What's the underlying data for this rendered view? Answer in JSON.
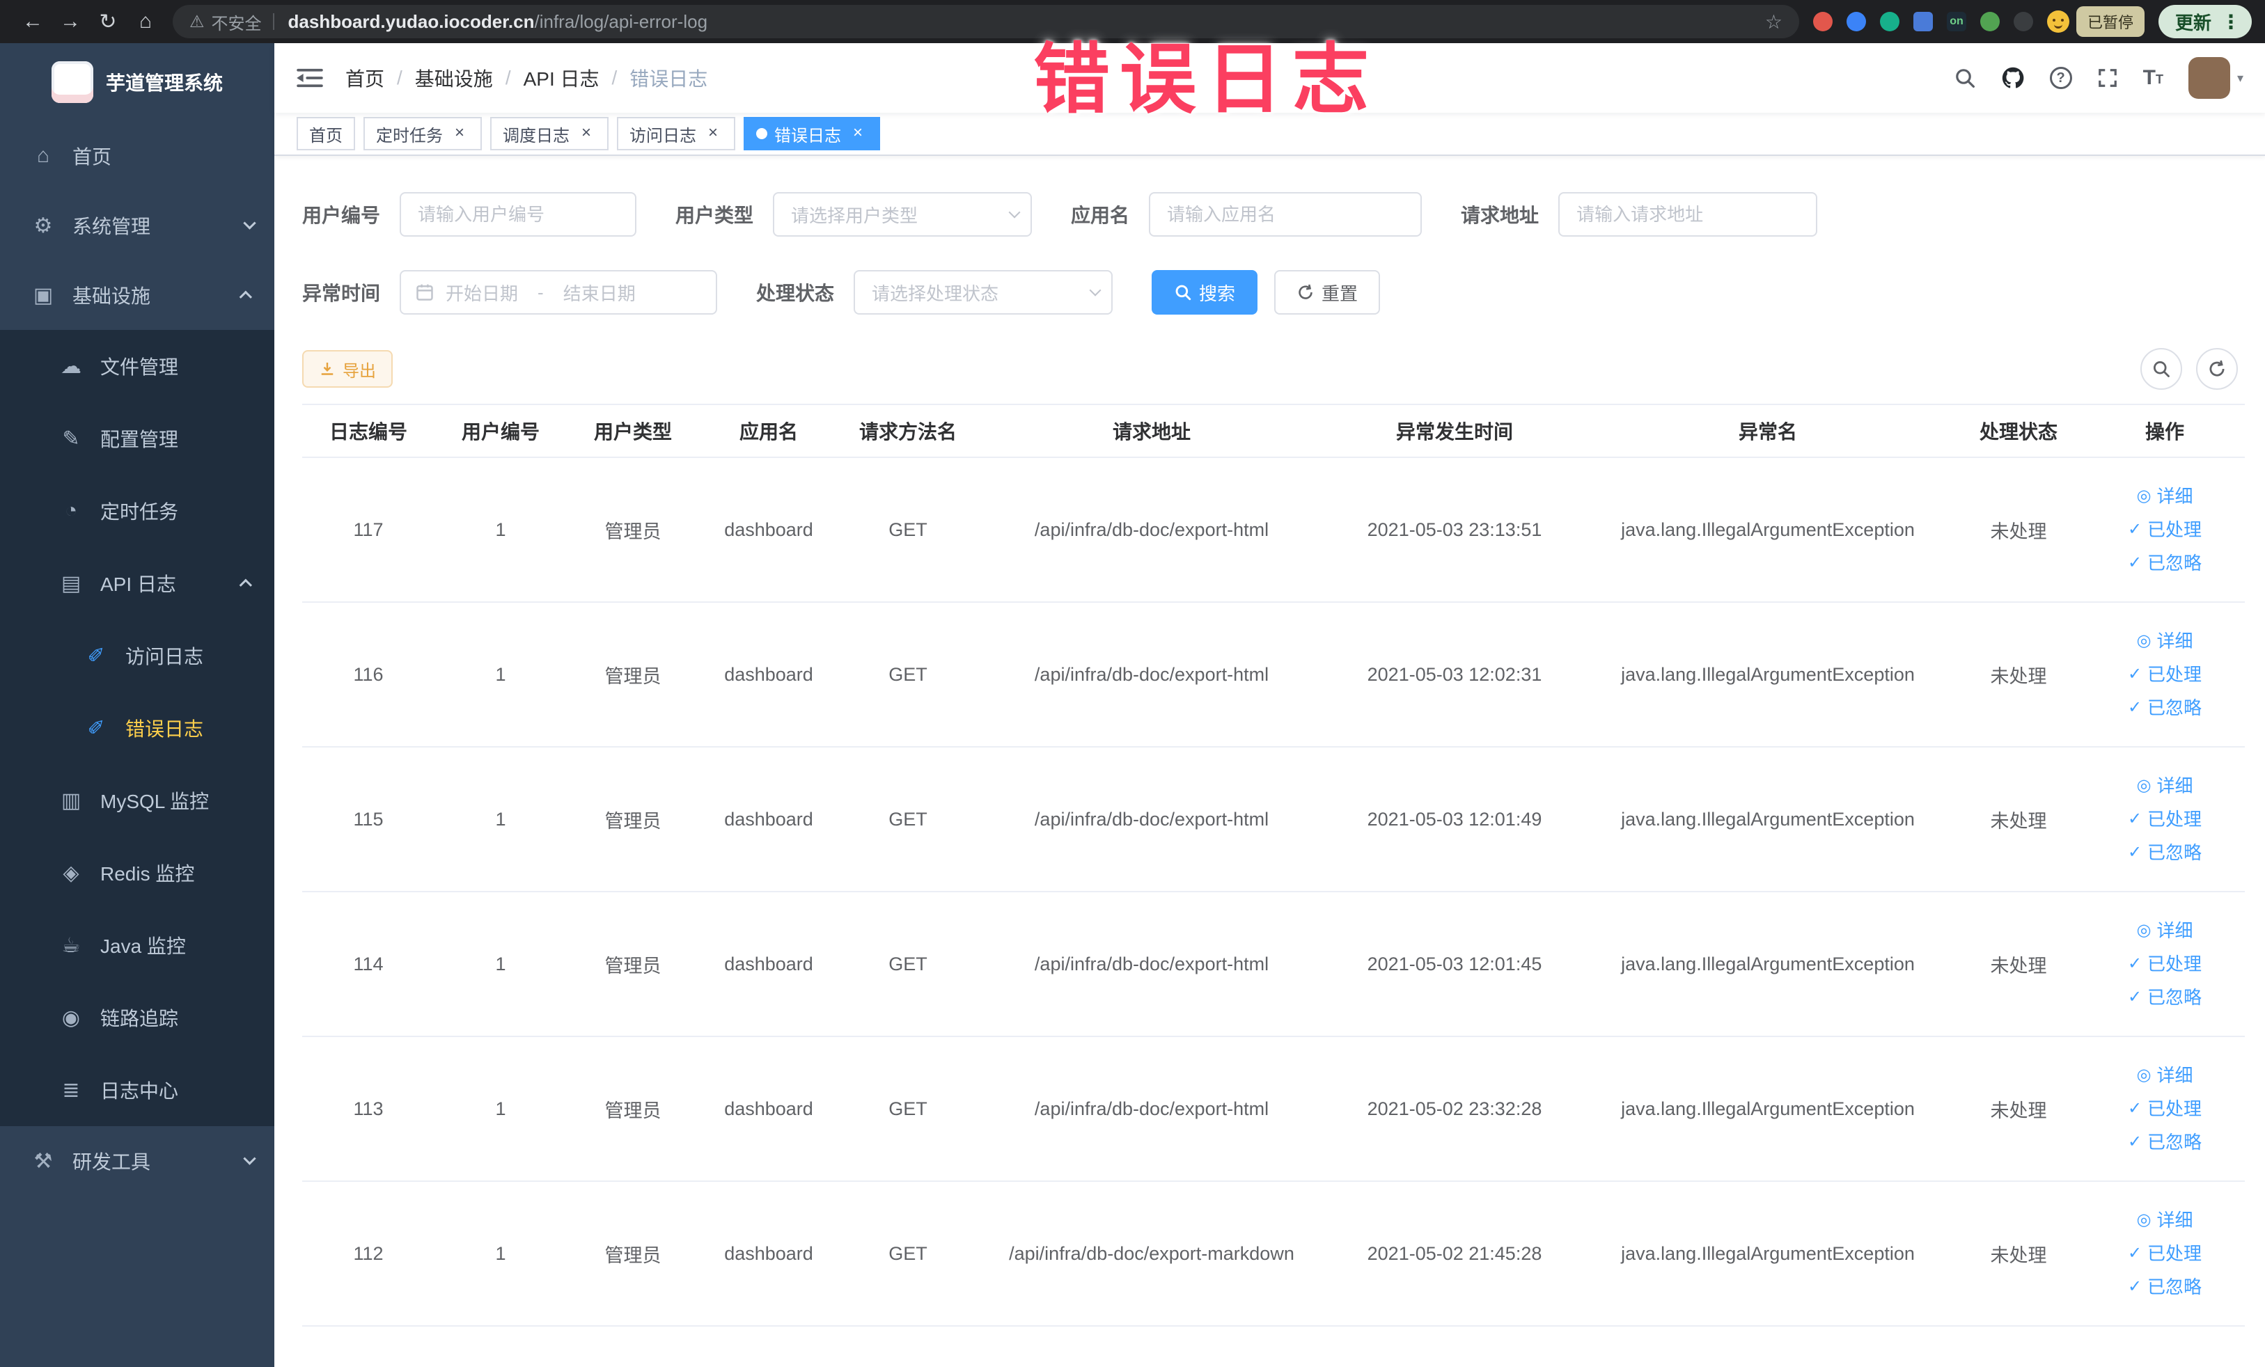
{
  "colors": {
    "primary": "#409eff",
    "sidebar_bg": "#304156",
    "submenu_bg": "#1f2d3d",
    "menu_text": "#bfcbd9",
    "active_menu_text": "#ffd04b",
    "annotation": "#fb3f60",
    "warning": "#e6a23c"
  },
  "icons": {
    "back": "←",
    "forward": "→",
    "reload": "↻",
    "home_nav": "⌂",
    "warning": "⚠",
    "star": "☆",
    "kebab": "⋮",
    "caret_down": "▾",
    "home": "⌂",
    "system": "⚙",
    "infra": "▣",
    "file": "☁",
    "config": "✎",
    "job": "◔",
    "api_log": "▤",
    "access_log": "✐",
    "error_log": "✐",
    "mysql": "▥",
    "redis": "◈",
    "java": "☕",
    "trace": "◉",
    "log_center": "≣",
    "dev_tools": "⚒",
    "eye": "◎",
    "check": "✓"
  },
  "browser": {
    "security_label": "不安全",
    "url_host": "dashboard.yudao.iocoder.cn",
    "url_path": "/infra/log/api-error-log",
    "extension_on_label": "on",
    "paused_badge": "已暂停",
    "update_button": "更新"
  },
  "annotation": {
    "text": "错误日志"
  },
  "sidebar": {
    "title": "芋道管理系统",
    "home": "首页",
    "system": "系统管理",
    "infra": "基础设施",
    "file": "文件管理",
    "config": "配置管理",
    "job": "定时任务",
    "api_log": "API 日志",
    "access_log": "访问日志",
    "error_log": "错误日志",
    "mysql": "MySQL 监控",
    "redis": "Redis 监控",
    "java": "Java 监控",
    "trace": "链路追踪",
    "log_center": "日志中心",
    "dev_tools": "研发工具"
  },
  "breadcrumb": [
    "首页",
    "基础设施",
    "API 日志",
    "错误日志"
  ],
  "tabs": [
    {
      "label": "首页"
    },
    {
      "label": "定时任务"
    },
    {
      "label": "调度日志"
    },
    {
      "label": "访问日志"
    },
    {
      "label": "错误日志"
    }
  ],
  "filters": {
    "user_id": {
      "label": "用户编号",
      "placeholder": "请输入用户编号"
    },
    "user_type": {
      "label": "用户类型",
      "placeholder": "请选择用户类型"
    },
    "app_name": {
      "label": "应用名",
      "placeholder": "请输入应用名"
    },
    "request_url": {
      "label": "请求地址",
      "placeholder": "请输入请求地址"
    },
    "exception_time": {
      "label": "异常时间",
      "start_placeholder": "开始日期",
      "separator": "-",
      "end_placeholder": "结束日期"
    },
    "process_status": {
      "label": "处理状态",
      "placeholder": "请选择处理状态"
    },
    "search_button": "搜索",
    "reset_button": "重置"
  },
  "toolbar": {
    "export_button": "导出"
  },
  "table": {
    "columns": [
      "日志编号",
      "用户编号",
      "用户类型",
      "应用名",
      "请求方法名",
      "请求地址",
      "异常发生时间",
      "异常名",
      "处理状态",
      "操作"
    ],
    "actions": [
      "详细",
      "已处理",
      "已忽略"
    ],
    "rows": [
      {
        "id": 117,
        "user_id": 1,
        "user_type": "管理员",
        "app": "dashboard",
        "method": "GET",
        "url": "/api/infra/db-doc/export-html",
        "time": "2021-05-03 23:13:51",
        "exception": "java.lang.IllegalArgumentException",
        "status": "未处理"
      },
      {
        "id": 116,
        "user_id": 1,
        "user_type": "管理员",
        "app": "dashboard",
        "method": "GET",
        "url": "/api/infra/db-doc/export-html",
        "time": "2021-05-03 12:02:31",
        "exception": "java.lang.IllegalArgumentException",
        "status": "未处理"
      },
      {
        "id": 115,
        "user_id": 1,
        "user_type": "管理员",
        "app": "dashboard",
        "method": "GET",
        "url": "/api/infra/db-doc/export-html",
        "time": "2021-05-03 12:01:49",
        "exception": "java.lang.IllegalArgumentException",
        "status": "未处理"
      },
      {
        "id": 114,
        "user_id": 1,
        "user_type": "管理员",
        "app": "dashboard",
        "method": "GET",
        "url": "/api/infra/db-doc/export-html",
        "time": "2021-05-03 12:01:45",
        "exception": "java.lang.IllegalArgumentException",
        "status": "未处理"
      },
      {
        "id": 113,
        "user_id": 1,
        "user_type": "管理员",
        "app": "dashboard",
        "method": "GET",
        "url": "/api/infra/db-doc/export-html",
        "time": "2021-05-02 23:32:28",
        "exception": "java.lang.IllegalArgumentException",
        "status": "未处理"
      },
      {
        "id": 112,
        "user_id": 1,
        "user_type": "管理员",
        "app": "dashboard",
        "method": "GET",
        "url": "/api/infra/db-doc/export-markdown",
        "time": "2021-05-02 21:45:28",
        "exception": "java.lang.IllegalArgumentException",
        "status": "未处理"
      }
    ]
  }
}
